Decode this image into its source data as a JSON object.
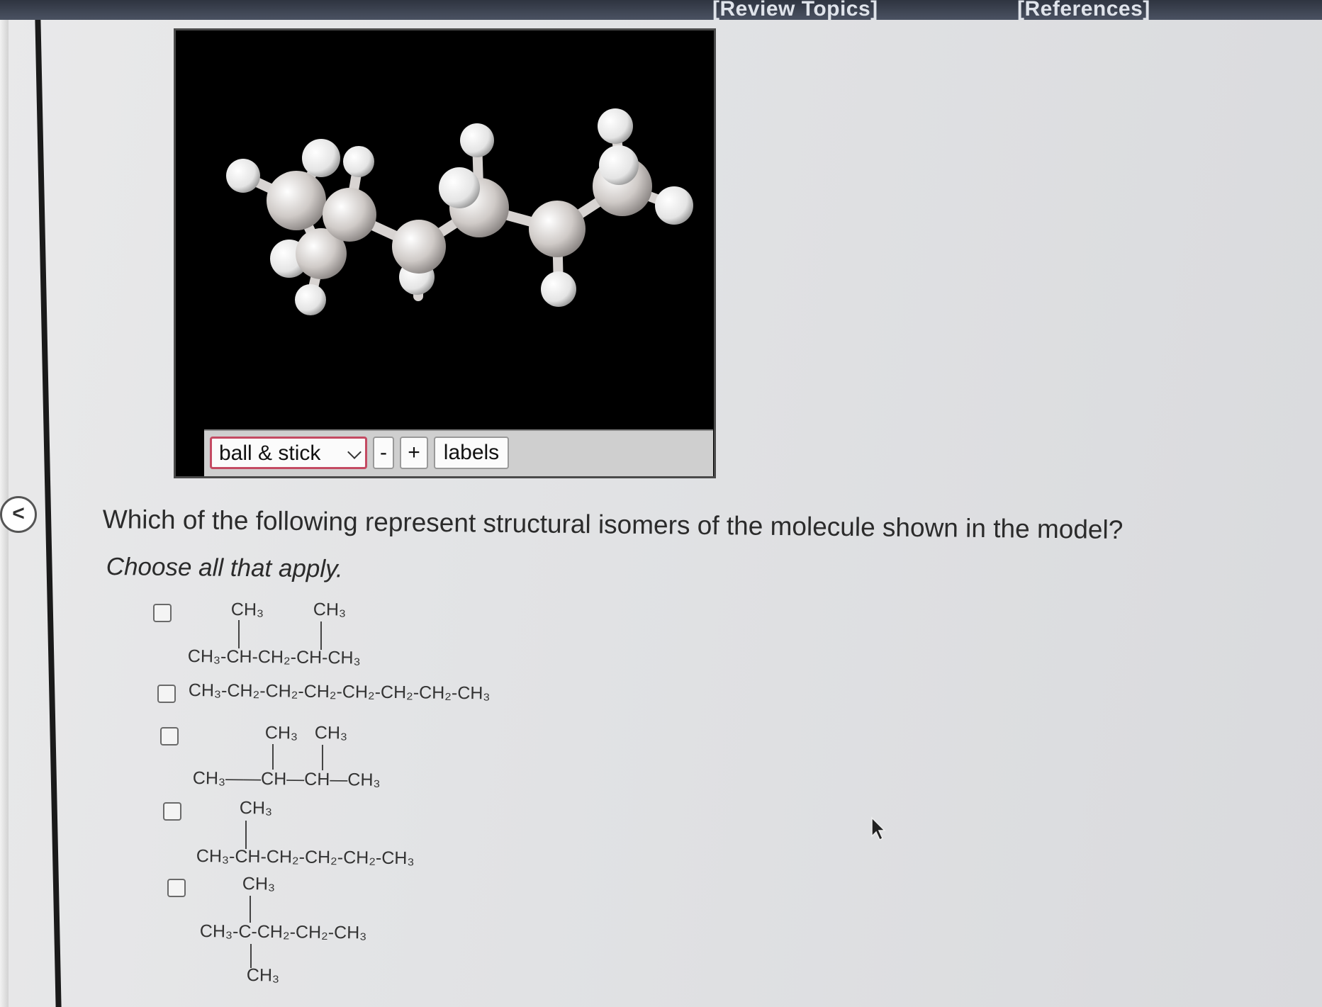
{
  "header": {
    "review_topics": "[Review Topics]",
    "references": "[References]"
  },
  "sidebar": {
    "collapse_label": "<"
  },
  "viewer": {
    "model_type": "ball & stick",
    "zoom_out_label": "-",
    "zoom_in_label": "+",
    "labels_button": "labels"
  },
  "question": {
    "prompt": "Which of the following represent structural isomers of the molecule shown in the model?",
    "instruction": "Choose all that apply."
  },
  "options": [
    {
      "branch_1": "CH₃",
      "branch_2": "CH₃",
      "chain": "CH₃-CH-CH₂-CH-CH₃"
    },
    {
      "chain": "CH₃-CH₂-CH₂-CH₂-CH₂-CH₂-CH₂-CH₃"
    },
    {
      "branch_1": "CH₃",
      "branch_2": "CH₃",
      "chain": "CH₃——CH—CH—CH₃"
    },
    {
      "branch_1": "CH₃",
      "chain": "CH₃-CH-CH₂-CH₂-CH₂-CH₃"
    },
    {
      "branch_top": "CH₃",
      "chain": "CH₃-C-CH₂-CH₂-CH₃",
      "branch_bottom": "CH₃"
    }
  ],
  "colors": {
    "viewer_background": "#000000",
    "select_border": "#c44a62",
    "topbar": "#2e3440"
  }
}
